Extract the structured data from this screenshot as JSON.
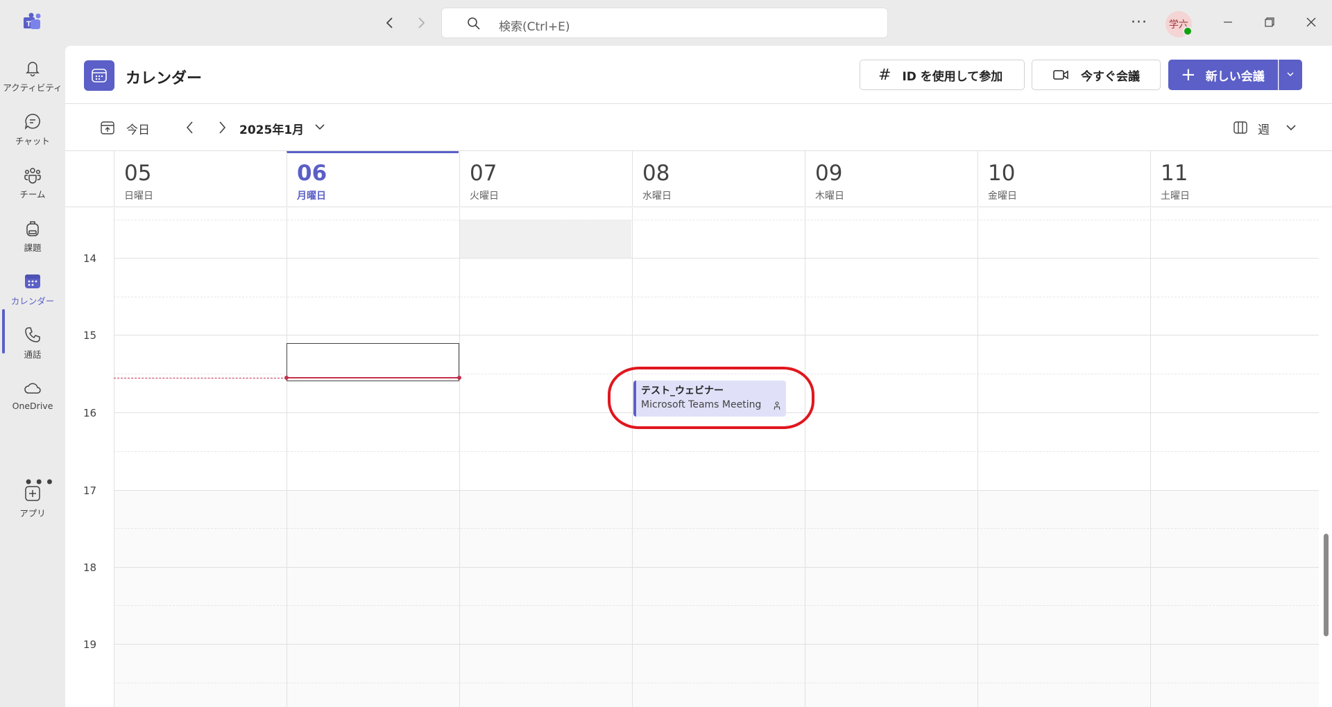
{
  "search": {
    "placeholder": "検索(Ctrl+E)"
  },
  "account": {
    "avatar_initials": "学六",
    "presence": "available"
  },
  "rail": {
    "items": [
      {
        "label": "アクティビティ",
        "icon": "bell-icon"
      },
      {
        "label": "チャット",
        "icon": "chat-icon"
      },
      {
        "label": "チーム",
        "icon": "teams-icon"
      },
      {
        "label": "課題",
        "icon": "backpack-icon"
      },
      {
        "label": "カレンダー",
        "icon": "calendar-icon",
        "active": true
      },
      {
        "label": "通話",
        "icon": "phone-icon"
      },
      {
        "label": "OneDrive",
        "icon": "cloud-icon"
      },
      {
        "label": "アプリ",
        "icon": "add-app-icon"
      }
    ]
  },
  "header": {
    "title": "カレンダー",
    "join_id_label": "ID を使用して参加",
    "meet_now_label": "今すぐ会議",
    "new_meeting_label": "新しい会議"
  },
  "toolbar": {
    "today_label": "今日",
    "month_label": "2025年1月",
    "view_label": "週"
  },
  "days": [
    {
      "num": "05",
      "dow": "日曜日"
    },
    {
      "num": "06",
      "dow": "月曜日",
      "today": true
    },
    {
      "num": "07",
      "dow": "火曜日"
    },
    {
      "num": "08",
      "dow": "水曜日"
    },
    {
      "num": "09",
      "dow": "木曜日"
    },
    {
      "num": "10",
      "dow": "金曜日"
    },
    {
      "num": "11",
      "dow": "土曜日"
    }
  ],
  "hours": [
    "14",
    "15",
    "16",
    "17",
    "18",
    "19"
  ],
  "event": {
    "title": "テスト_ウェビナー",
    "subtitle": "Microsoft Teams Meeting",
    "day": "08",
    "icon": "webinar-icon"
  },
  "colors": {
    "accent": "#5b5fc7",
    "event_bg": "#e0e1f8",
    "now_line": "#c4314b",
    "highlight": "#e0171e"
  }
}
